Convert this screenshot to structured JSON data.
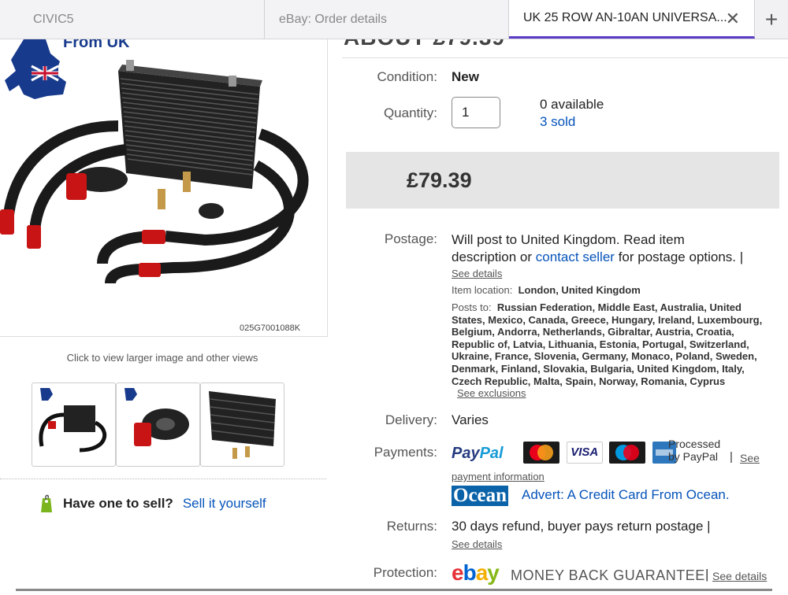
{
  "tabs": [
    {
      "label": "CIVIC5"
    },
    {
      "label": "eBay: Order details"
    },
    {
      "label": "UK 25 ROW AN-10AN UNIVERSA..."
    }
  ],
  "image": {
    "banner_text": "From UK",
    "watermark": "025G7001088K"
  },
  "left": {
    "click_hint": "Click to view larger image and other views",
    "thumb_count": 3,
    "sell_question": "Have one to sell?",
    "sell_link": "Sell it yourself"
  },
  "listing": {
    "condition_label": "Condition:",
    "condition_value": "New",
    "quantity_label": "Quantity:",
    "quantity_value": "1",
    "available": "0 available",
    "sold": "3 sold",
    "price": "£79.39"
  },
  "postage": {
    "label": "Postage:",
    "text_1": "Will post to United Kingdom. Read item",
    "text_2a": "description or",
    "text_2_link": "contact seller",
    "text_2b": "for postage options. |",
    "see_details": "See details",
    "location_label": "Item location:",
    "location_value": "London, United Kingdom",
    "posts_to_label": "Posts to:",
    "posts_to_value": "Russian Federation, Middle East, Australia, United States, Mexico, Canada, Greece, Hungary, Ireland, Luxembourg, Belgium, Andorra, Netherlands, Gibraltar, Austria, Croatia, Republic of, Latvia, Lithuania, Estonia, Portugal, Switzerland, Ukraine, France, Slovenia, Germany, Monaco, Poland, Sweden, Denmark, Finland, Slovakia, Bulgaria, United Kingdom, Italy, Czech Republic, Malta, Spain, Norway, Romania, Cyprus",
    "see_exclusions": "See exclusions"
  },
  "delivery": {
    "label": "Delivery:",
    "value": "Varies"
  },
  "payments": {
    "label": "Payments:",
    "paypal": "PayPal",
    "cards": [
      "MasterCard",
      "VISA",
      "Maestro",
      "AMEX"
    ],
    "processed_1": "Processed",
    "processed_2": "by PayPal",
    "see_1": "See",
    "see_2": "payment information",
    "ocean_logo": "Ocean",
    "ocean_advert": "Advert: A Credit Card From Ocean."
  },
  "returns": {
    "label": "Returns:",
    "value": "30 days refund, buyer pays return postage |",
    "see_details": "See details"
  },
  "protection": {
    "label": "Protection:",
    "ebay_logo": "ebay",
    "guarantee": "MONEY BACK GUARANTEE",
    "see_details": "See details"
  },
  "colors": {
    "link": "#0654ba",
    "tab_active_underline": "#5b3cc4",
    "price_bg": "#e5e5e5",
    "paypal_dark": "#253b80",
    "paypal_light": "#179bd7",
    "ocean_bg": "#0a62a8",
    "sell_tag": "#7ab51d"
  }
}
